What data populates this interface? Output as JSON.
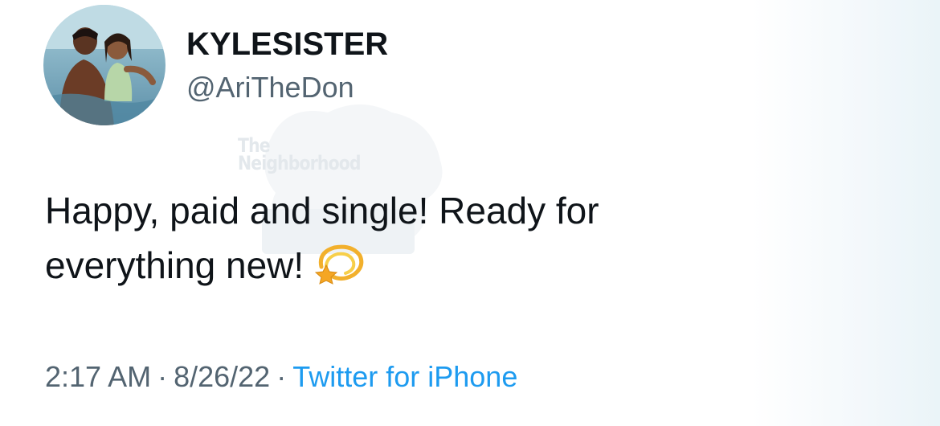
{
  "user": {
    "display_name": "KYLESISTER",
    "handle": "@AriTheDon",
    "avatar_icon": "profile-photo"
  },
  "tweet": {
    "text_line1": "Happy, paid and single! Ready for",
    "text_line2": "everything new!",
    "emoji_icon": "dizzy-emoji-icon"
  },
  "meta": {
    "time": "2:17 AM",
    "date": "8/26/22",
    "separator": "·",
    "source": "Twitter for iPhone"
  },
  "watermark": {
    "line1": "The",
    "line2": "Neighborhood"
  },
  "colors": {
    "text_primary": "#0f1419",
    "text_secondary": "#536471",
    "accent": "#1d9bf0"
  }
}
